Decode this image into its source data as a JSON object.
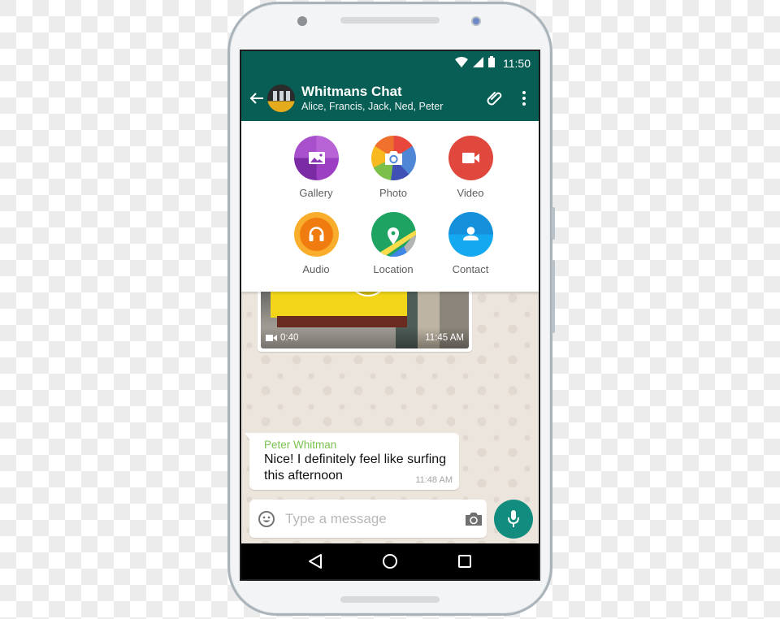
{
  "status_bar": {
    "time": "11:50",
    "icons": [
      "wifi-icon",
      "cellular-signal-icon",
      "battery-icon"
    ]
  },
  "app_bar": {
    "back_icon": "arrow-left-icon",
    "title": "Whitmans Chat",
    "subtitle": "Alice, Francis, Jack, Ned, Peter",
    "actions": [
      "paperclip-icon",
      "more-vertical-icon"
    ],
    "color": "#075e54"
  },
  "attach_menu": {
    "items": [
      {
        "label": "Gallery",
        "icon": "gallery-icon",
        "color": "#a24ec8"
      },
      {
        "label": "Photo",
        "icon": "camera-icon",
        "color": "#f0702e"
      },
      {
        "label": "Video",
        "icon": "video-camera-icon",
        "color": "#e0483d"
      },
      {
        "label": "Audio",
        "icon": "headphones-icon",
        "color": "#f5841f"
      },
      {
        "label": "Location",
        "icon": "map-pin-icon",
        "color": "#1ea362"
      },
      {
        "label": "Contact",
        "icon": "person-icon",
        "color": "#1b9ce5"
      }
    ]
  },
  "messages": [
    {
      "type": "video",
      "duration": "0:40",
      "time": "11:45 AM"
    },
    {
      "type": "text",
      "sender": "Peter Whitman",
      "text_line1": "Nice! I definitely feel like surfing",
      "text_line2": "this afternoon",
      "time": "11:48 AM",
      "sender_color": "#7cc250"
    }
  ],
  "composer": {
    "placeholder": "Type a message",
    "value": "",
    "emoji_icon": "smiley-icon",
    "camera_icon": "camera-icon",
    "mic_icon": "microphone-icon",
    "mic_color": "#128c7e"
  },
  "nav_bar": {
    "buttons": [
      "back-triangle-icon",
      "home-circle-icon",
      "recents-square-icon"
    ]
  }
}
